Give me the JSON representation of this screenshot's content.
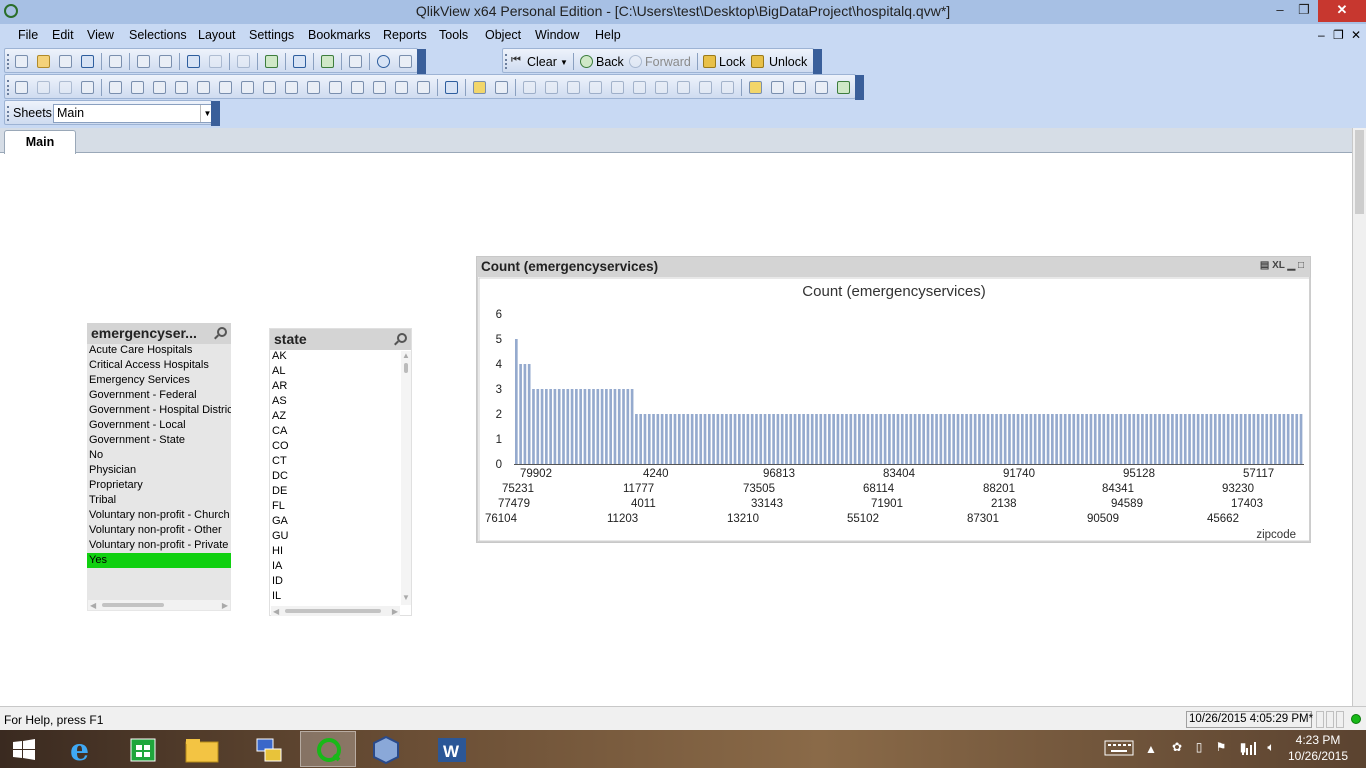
{
  "window": {
    "title": "QlikView x64 Personal Edition - [C:\\Users\\test\\Desktop\\BigDataProject\\hospitalq.qvw*]"
  },
  "menu": [
    "File",
    "Edit",
    "View",
    "Selections",
    "Layout",
    "Settings",
    "Bookmarks",
    "Reports",
    "Tools",
    "Object",
    "Window",
    "Help"
  ],
  "toolbar": {
    "clear": "Clear",
    "back": "Back",
    "forward": "Forward",
    "lock": "Lock",
    "unlock": "Unlock"
  },
  "sheets": {
    "label": "Sheets",
    "current": "Main"
  },
  "tabs": [
    "Main"
  ],
  "listbox_emergency": {
    "caption": "emergencyser...",
    "items": [
      "Acute Care Hospitals",
      "Critical Access Hospitals",
      "Emergency Services",
      "Government - Federal",
      "Government - Hospital District",
      "Government - Local",
      "Government - State",
      "No",
      "Physician",
      "Proprietary",
      "Tribal",
      "Voluntary non-profit - Church",
      "Voluntary non-profit - Other",
      "Voluntary non-profit - Private",
      "Yes"
    ],
    "selected": "Yes"
  },
  "listbox_state": {
    "caption": "state",
    "items": [
      "AK",
      "AL",
      "AR",
      "AS",
      "AZ",
      "CA",
      "CO",
      "CT",
      "DC",
      "DE",
      "FL",
      "GA",
      "GU",
      "HI",
      "IA",
      "ID",
      "IL"
    ]
  },
  "chart_object": {
    "caption": "Count (emergencyservices)",
    "icons": "XL"
  },
  "chart_data": {
    "type": "bar",
    "title": "Count (emergencyservices)",
    "xlabel": "zipcode",
    "ylabel": "",
    "ylim": [
      0,
      6
    ],
    "yticks": [
      0,
      1,
      2,
      3,
      4,
      5,
      6
    ],
    "grid": false,
    "values": [
      5,
      4,
      4,
      4,
      3,
      3,
      3,
      3,
      3,
      3,
      3,
      3,
      3,
      3,
      3,
      3,
      3,
      3,
      3,
      3,
      3,
      3,
      3,
      3,
      3,
      3,
      3,
      3,
      2,
      2,
      2,
      2,
      2,
      2,
      2,
      2,
      2,
      2,
      2,
      2,
      2,
      2,
      2,
      2,
      2,
      2,
      2,
      2,
      2,
      2,
      2,
      2,
      2,
      2,
      2,
      2,
      2,
      2,
      2,
      2,
      2,
      2,
      2,
      2,
      2,
      2,
      2,
      2,
      2,
      2,
      2,
      2,
      2,
      2,
      2,
      2,
      2,
      2,
      2,
      2,
      2,
      2,
      2,
      2,
      2,
      2,
      2,
      2,
      2,
      2,
      2,
      2,
      2,
      2,
      2,
      2,
      2,
      2,
      2,
      2,
      2,
      2,
      2,
      2,
      2,
      2,
      2,
      2,
      2,
      2,
      2,
      2,
      2,
      2,
      2,
      2,
      2,
      2,
      2,
      2,
      2,
      2,
      2,
      2,
      2,
      2,
      2,
      2,
      2,
      2,
      2,
      2,
      2,
      2,
      2,
      2,
      2,
      2,
      2,
      2,
      2,
      2,
      2,
      2,
      2,
      2,
      2,
      2,
      2,
      2,
      2,
      2,
      2,
      2,
      2,
      2,
      2,
      2,
      2,
      2,
      2,
      2,
      2,
      2,
      2,
      2,
      2,
      2,
      2,
      2,
      2,
      2,
      2,
      2,
      2,
      2,
      2,
      2,
      2,
      2,
      2,
      2,
      2,
      2
    ],
    "xtick_labels": [
      [
        "79902",
        "4240",
        "96813",
        "83404",
        "91740",
        "95128",
        "57117"
      ],
      [
        "75231",
        "11777",
        "73505",
        "68114",
        "88201",
        "84341",
        "93230"
      ],
      [
        "77479",
        "4011",
        "33143",
        "71901",
        "2138",
        "94589",
        "17403"
      ],
      [
        "76104",
        "11203",
        "13210",
        "55102",
        "87301",
        "90509",
        "45662"
      ]
    ]
  },
  "status": {
    "help": "For Help, press F1",
    "timestamp": "10/26/2015 4:05:29 PM*"
  },
  "taskbar": {
    "time": "4:23 PM",
    "date": "10/26/2015"
  }
}
